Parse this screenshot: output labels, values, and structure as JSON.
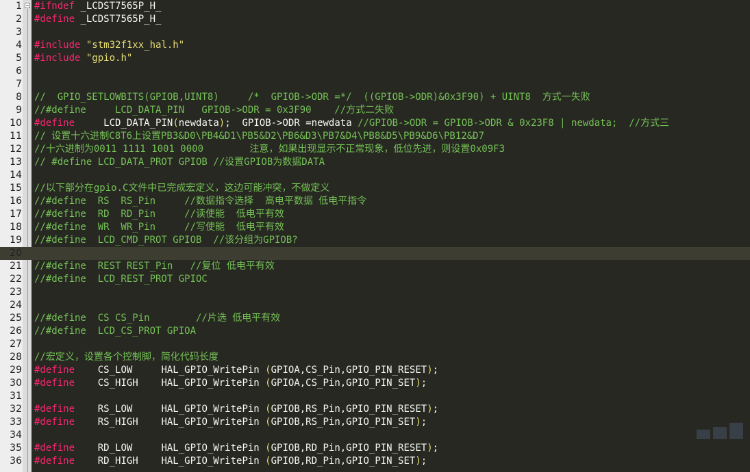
{
  "editor": {
    "lines": [
      {
        "n": "1",
        "tokens": [
          {
            "t": "directive",
            "v": "#ifndef"
          },
          {
            "t": "plain",
            "v": " _LCDST7565P_H_"
          }
        ]
      },
      {
        "n": "2",
        "tokens": [
          {
            "t": "directive",
            "v": "#define"
          },
          {
            "t": "plain",
            "v": " _LCDST7565P_H_"
          }
        ]
      },
      {
        "n": "3",
        "tokens": []
      },
      {
        "n": "4",
        "tokens": [
          {
            "t": "directive",
            "v": "#include"
          },
          {
            "t": "plain",
            "v": " "
          },
          {
            "t": "string",
            "v": "\"stm32f1xx_hal.h\""
          }
        ]
      },
      {
        "n": "5",
        "tokens": [
          {
            "t": "directive",
            "v": "#include"
          },
          {
            "t": "plain",
            "v": " "
          },
          {
            "t": "string",
            "v": "\"gpio.h\""
          }
        ]
      },
      {
        "n": "6",
        "tokens": []
      },
      {
        "n": "7",
        "tokens": []
      },
      {
        "n": "8",
        "tokens": [
          {
            "t": "comment",
            "v": "//  GPIO_SETLOWBITS(GPIOB,UINT8)     /*  GPIOB->ODR =*/  ((GPIOB->ODR)&0x3F90) + UINT8  方式一失败"
          }
        ]
      },
      {
        "n": "9",
        "tokens": [
          {
            "t": "comment",
            "v": "//#define     LCD_DATA_PIN   GPIOB->ODR = 0x3F90    //方式二失败"
          }
        ]
      },
      {
        "n": "10",
        "tokens": [
          {
            "t": "directive",
            "v": "#define"
          },
          {
            "t": "plain",
            "v": "     LCD_DATA_PIN"
          },
          {
            "t": "paren",
            "v": "("
          },
          {
            "t": "plain",
            "v": "newdata"
          },
          {
            "t": "paren",
            "v": ")"
          },
          {
            "t": "plain",
            "v": ";  GPIOB->ODR =newdata "
          },
          {
            "t": "comment",
            "v": "//GPIOB->ODR = GPIOB->ODR & 0x23F8 | newdata;  //方式三"
          }
        ]
      },
      {
        "n": "11",
        "tokens": [
          {
            "t": "comment",
            "v": "// 设置十六进制C8T6上设置PB3&D0\\PB4&D1\\PB5&D2\\PB6&D3\\PB7&D4\\PB8&D5\\PB9&D6\\PB12&D7"
          }
        ]
      },
      {
        "n": "12",
        "tokens": [
          {
            "t": "comment",
            "v": "//十六进制为0011 1111 1001 0000        注意，如果出现显示不正常现象，低位先进，则设置0x09F3"
          }
        ]
      },
      {
        "n": "13",
        "tokens": [
          {
            "t": "comment",
            "v": "// #define LCD_DATA_PROT GPIOB //设置GPIOB为数据DATA"
          }
        ]
      },
      {
        "n": "14",
        "tokens": []
      },
      {
        "n": "15",
        "tokens": [
          {
            "t": "comment",
            "v": "//以下部分在gpio.C文件中已完成宏定义，这边可能冲突，不做定义"
          }
        ]
      },
      {
        "n": "16",
        "tokens": [
          {
            "t": "comment",
            "v": "//#define  RS  RS_Pin     //数据指令选择  高电平数据 低电平指令"
          }
        ]
      },
      {
        "n": "17",
        "tokens": [
          {
            "t": "comment",
            "v": "//#define  RD  RD_Pin     //读使能  低电平有效"
          }
        ]
      },
      {
        "n": "18",
        "tokens": [
          {
            "t": "comment",
            "v": "//#define  WR  WR_Pin     //写使能  低电平有效"
          }
        ]
      },
      {
        "n": "19",
        "tokens": [
          {
            "t": "comment",
            "v": "//#define  LCD_CMD_PROT GPIOB  //该分组为GPIOB?"
          }
        ]
      },
      {
        "n": "20",
        "tokens": [],
        "current": true
      },
      {
        "n": "21",
        "tokens": [
          {
            "t": "comment",
            "v": "//#define  REST REST_Pin   //复位 低电平有效"
          }
        ]
      },
      {
        "n": "22",
        "tokens": [
          {
            "t": "comment",
            "v": "//#define  LCD_REST_PROT GPIOC"
          }
        ]
      },
      {
        "n": "23",
        "tokens": []
      },
      {
        "n": "24",
        "tokens": []
      },
      {
        "n": "25",
        "tokens": [
          {
            "t": "comment",
            "v": "//#define  CS CS_Pin        //片选 低电平有效"
          }
        ]
      },
      {
        "n": "26",
        "tokens": [
          {
            "t": "comment",
            "v": "//#define  LCD_CS_PROT GPIOA"
          }
        ]
      },
      {
        "n": "27",
        "tokens": []
      },
      {
        "n": "28",
        "tokens": [
          {
            "t": "comment",
            "v": "//宏定义，设置各个控制脚，简化代码长度"
          }
        ]
      },
      {
        "n": "29",
        "tokens": [
          {
            "t": "directive",
            "v": "#define"
          },
          {
            "t": "plain",
            "v": "    CS_LOW     HAL_GPIO_WritePin "
          },
          {
            "t": "paren",
            "v": "("
          },
          {
            "t": "plain",
            "v": "GPIOA,CS_Pin,GPIO_PIN_RESET"
          },
          {
            "t": "paren",
            "v": ")"
          },
          {
            "t": "plain",
            "v": ";"
          }
        ]
      },
      {
        "n": "30",
        "tokens": [
          {
            "t": "directive",
            "v": "#define"
          },
          {
            "t": "plain",
            "v": "    CS_HIGH    HAL_GPIO_WritePin "
          },
          {
            "t": "paren",
            "v": "("
          },
          {
            "t": "plain",
            "v": "GPIOA,CS_Pin,GPIO_PIN_SET"
          },
          {
            "t": "paren",
            "v": ")"
          },
          {
            "t": "plain",
            "v": ";"
          }
        ]
      },
      {
        "n": "31",
        "tokens": []
      },
      {
        "n": "32",
        "tokens": [
          {
            "t": "directive",
            "v": "#define"
          },
          {
            "t": "plain",
            "v": "    RS_LOW     HAL_GPIO_WritePin "
          },
          {
            "t": "paren",
            "v": "("
          },
          {
            "t": "plain",
            "v": "GPIOB,RS_Pin,GPIO_PIN_RESET"
          },
          {
            "t": "paren",
            "v": ")"
          },
          {
            "t": "plain",
            "v": ";"
          }
        ]
      },
      {
        "n": "33",
        "tokens": [
          {
            "t": "directive",
            "v": "#define"
          },
          {
            "t": "plain",
            "v": "    RS_HIGH    HAL_GPIO_WritePin "
          },
          {
            "t": "paren",
            "v": "("
          },
          {
            "t": "plain",
            "v": "GPIOB,RS_Pin,GPIO_PIN_SET"
          },
          {
            "t": "paren",
            "v": ")"
          },
          {
            "t": "plain",
            "v": ";"
          }
        ]
      },
      {
        "n": "34",
        "tokens": []
      },
      {
        "n": "35",
        "tokens": [
          {
            "t": "directive",
            "v": "#define"
          },
          {
            "t": "plain",
            "v": "    RD_LOW     HAL_GPIO_WritePin "
          },
          {
            "t": "paren",
            "v": "("
          },
          {
            "t": "plain",
            "v": "GPIOB,RD_Pin,GPIO_PIN_RESET"
          },
          {
            "t": "paren",
            "v": ")"
          },
          {
            "t": "plain",
            "v": ";"
          }
        ]
      },
      {
        "n": "36",
        "tokens": [
          {
            "t": "directive",
            "v": "#define"
          },
          {
            "t": "plain",
            "v": "    RD_HIGH    HAL_GPIO_WritePin "
          },
          {
            "t": "paren",
            "v": "("
          },
          {
            "t": "plain",
            "v": "GPIOB,RD_Pin,GPIO_PIN_SET"
          },
          {
            "t": "paren",
            "v": ")"
          },
          {
            "t": "plain",
            "v": ";"
          }
        ]
      }
    ]
  },
  "theme": {
    "background": "#272822",
    "current_line": "#3e3d32",
    "directive": "#f92672",
    "string": "#e6db74",
    "comment": "#75c156",
    "text": "#f8f8f2",
    "gutter": "#eeeeee"
  }
}
